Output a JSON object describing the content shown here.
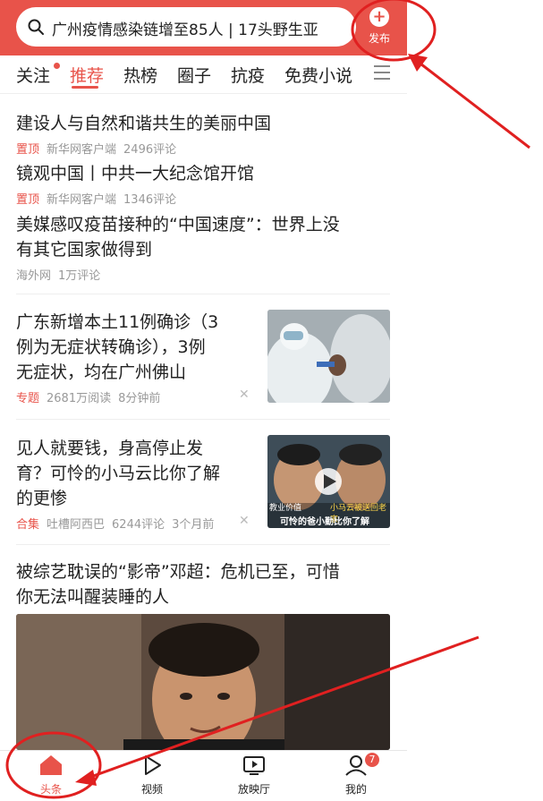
{
  "search": {
    "query": "广州疫情感染链增至85人 | 17头野生亚"
  },
  "publish": {
    "label": "发布"
  },
  "tabs": [
    "关注",
    "推荐",
    "热榜",
    "圈子",
    "抗疫",
    "免费小说"
  ],
  "feed": {
    "pinned": [
      {
        "title": "建设人与自然和谐共生的美丽中国",
        "tag": "置顶",
        "source": "新华网客户端",
        "comments": "2496评论"
      },
      {
        "title": "镜观中国丨中共一大纪念馆开馆",
        "tag": "置顶",
        "source": "新华网客户端",
        "comments": "1346评论"
      }
    ],
    "item3": {
      "title_line1": "美媒感叹疫苗接种的“中国速度”：世界上没",
      "title_line2": "有其它国家做得到",
      "source": "海外网",
      "comments": "1万评论"
    },
    "item4": {
      "title_line1": "广东新增本土11例确诊（3",
      "title_line2": "例为无症状转确诊），3例",
      "title_line3": "无症状，均在广州佛山",
      "tag": "专题",
      "reads": "2681万阅读",
      "time": "8分钟前"
    },
    "item5": {
      "title_line1": "见人就要钱，身高停止发",
      "title_line2": "育？可怜的小马云比你了解",
      "title_line3": "的更惨",
      "tag": "合集",
      "source": "吐槽阿西巴",
      "comments": "6244评论",
      "time": "3个月前",
      "thumb_caption_left": "教业价值",
      "thumb_caption_right": "小马云被送回老家",
      "thumb_caption_bottom": "可怜的爸小勤比你了解"
    },
    "item6": {
      "title_line1": "被综艺耽误的“影帝”邓超：危机已至，可惜",
      "title_line2": "你无法叫醒装睡的人"
    }
  },
  "bottom_nav": [
    {
      "label": "头条",
      "icon": "home-icon"
    },
    {
      "label": "视频",
      "icon": "play-icon"
    },
    {
      "label": "放映厅",
      "icon": "screen-icon"
    },
    {
      "label": "我的",
      "icon": "user-icon",
      "badge": "7"
    }
  ],
  "colors": {
    "accent": "#e8534a",
    "annotation": "#e02020"
  }
}
